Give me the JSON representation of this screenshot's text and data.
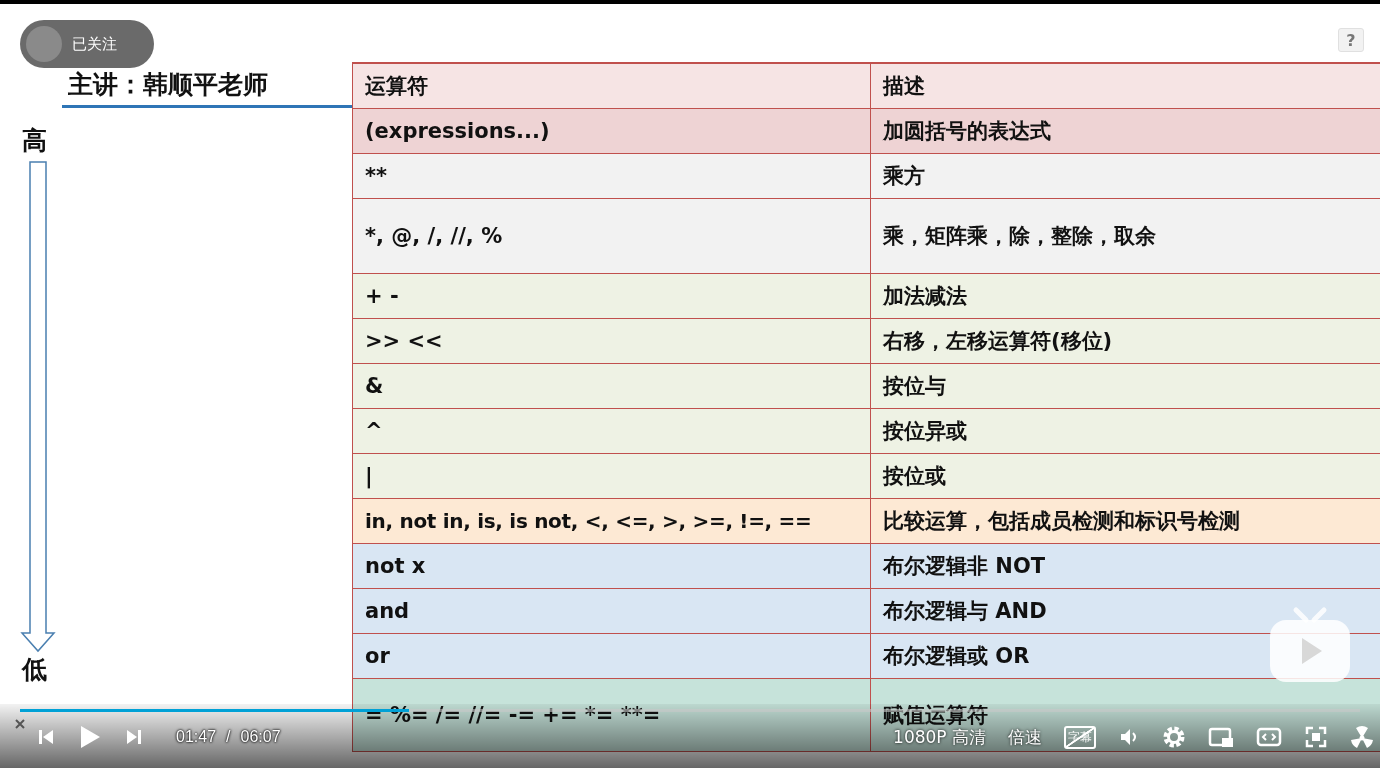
{
  "follow_badge": {
    "label": "已关注"
  },
  "help": {
    "label": "?"
  },
  "slide": {
    "lecturer": "主讲：韩顺平老师",
    "high_label": "高",
    "low_label": "低",
    "table": {
      "columns": [
        "运算符",
        "描述"
      ],
      "rows": [
        {
          "operator": "(expressions...)",
          "description": "加圆括号的表达式",
          "color": "#eed3d4"
        },
        {
          "operator": "**",
          "description": "乘方",
          "color": "#f2f2f2"
        },
        {
          "operator": "*, @, /, //, %",
          "description": "乘，矩阵乘，除，整除，取余",
          "color": "#f2f2f2"
        },
        {
          "operator": "+ -",
          "description": "加法减法",
          "color": "#eef2e4"
        },
        {
          "operator": ">> <<",
          "description": "右移，左移运算符(移位)",
          "color": "#eef2e4"
        },
        {
          "operator": "&",
          "description": "按位与",
          "color": "#eef2e4"
        },
        {
          "operator": "^",
          "description": "按位异或",
          "color": "#eef2e4"
        },
        {
          "operator": "|",
          "description": "按位或",
          "color": "#eef2e4"
        },
        {
          "operator": "in, not in, is, is not, <, <=, >, >=, !=, ==",
          "description": "比较运算，包括成员检测和标识号检测",
          "color": "#fde9d4"
        },
        {
          "operator": "not x",
          "description": "布尔逻辑非 NOT",
          "color": "#d9e6f3"
        },
        {
          "operator": "and",
          "description": "布尔逻辑与 AND",
          "color": "#d9e6f3"
        },
        {
          "operator": "or",
          "description": "布尔逻辑或 OR",
          "color": "#d9e6f3"
        },
        {
          "operator": "= %= /= //= -= += *= **=",
          "description": "赋值运算符",
          "color": "#c6e3da"
        }
      ]
    }
  },
  "player": {
    "progress": {
      "level": 0.29
    },
    "time_current": "01:47",
    "time_separator": "/",
    "time_total": "06:07",
    "quality": "1080P 高清",
    "speed": "倍速",
    "subtitle": "字幕"
  }
}
